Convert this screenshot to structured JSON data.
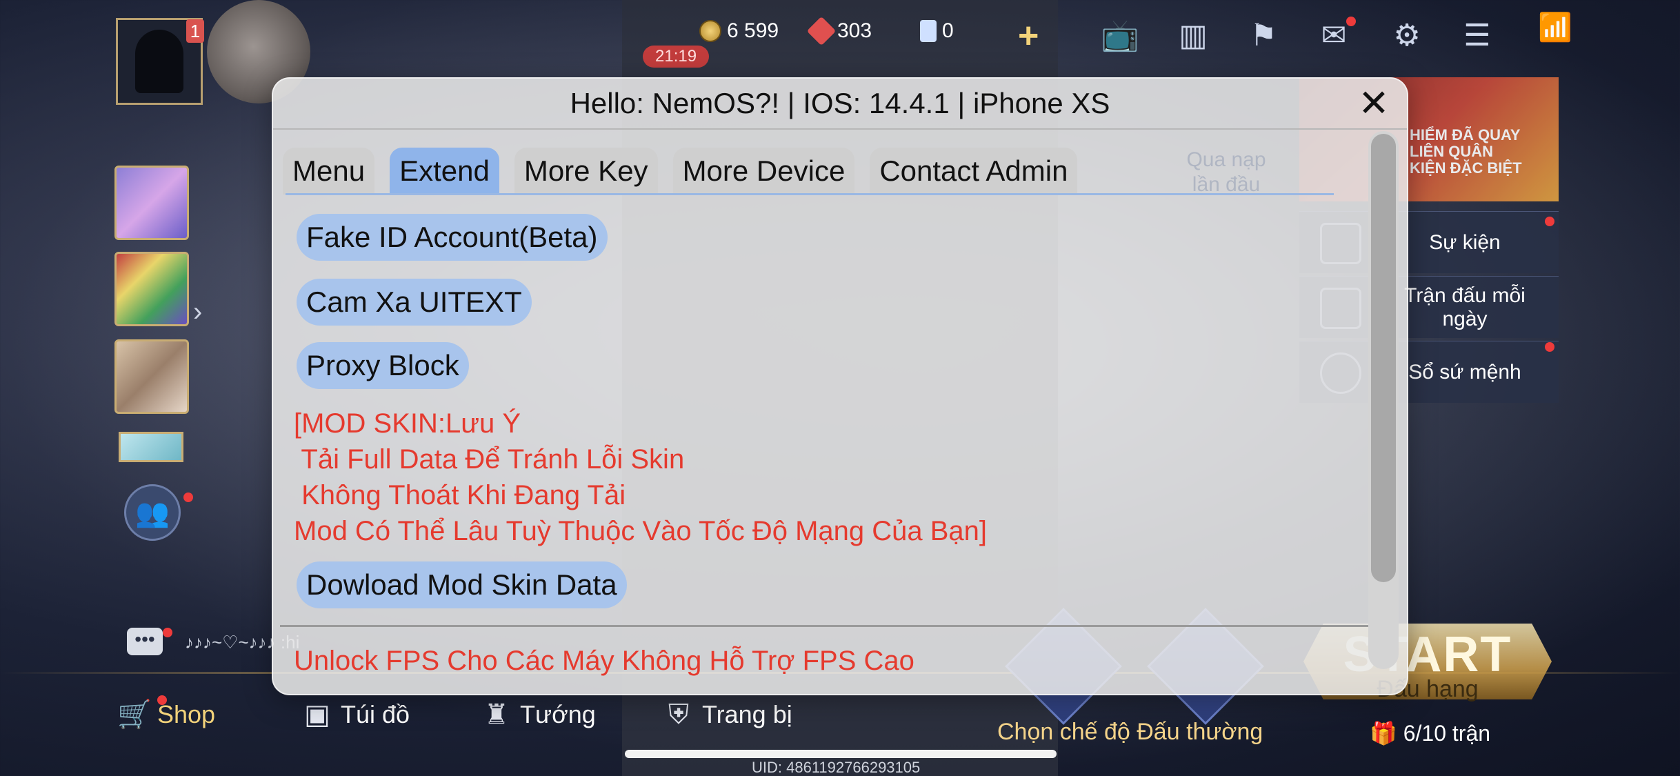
{
  "hud": {
    "coins": "6 599",
    "gems": "303",
    "vouchers": "0",
    "clock": "21:19",
    "notif_count": "1"
  },
  "events": {
    "banner_text": "HIỂM ĐÃ QUAY\nLIÊN QUÂN\nKIỆN ĐẶC BIỆT",
    "items": [
      "Sự kiện",
      "Trận đấu mỗi ngày",
      "Sổ sứ mệnh"
    ]
  },
  "background": {
    "ghost_qua": "Qua nạp\nlần đầu",
    "chat_text": "♪♪♪~♡~♪♪♪  :hi"
  },
  "bottom": {
    "shop": "Shop",
    "bag": "Túi đồ",
    "heroes": "Tướng",
    "equipment": "Trang bị",
    "start": "START",
    "start_sub": "Đấu hạng",
    "mode_label": "Chọn chế độ Đấu thường",
    "matches": "6/10 trận",
    "uid": "UID: 4861192766293105"
  },
  "panel": {
    "title": "Hello: NemOS?! | IOS: 14.4.1 | iPhone XS",
    "tabs": [
      {
        "label": "Menu"
      },
      {
        "label": "Extend"
      },
      {
        "label": "More Key"
      },
      {
        "label": "More Device"
      },
      {
        "label": "Contact Admin"
      }
    ],
    "active_tab": "Extend",
    "buttons": {
      "fake_id": "Fake ID Account(Beta)",
      "cam_xa": "Cam Xa UITEXT",
      "proxy_block": "Proxy Block",
      "download_skin": "Dowload Mod Skin Data"
    },
    "mod_note": {
      "line1": "[MOD SKIN:Lưu Ý",
      "line2": " Tải Full Data Để Tránh Lỗi Skin",
      "line3": " Không Thoát Khi Đang Tải",
      "line4": "Mod Có Thể Lâu Tuỳ Thuộc Vào Tốc Độ Mạng Của Bạn]"
    },
    "fps_note": "Unlock FPS Cho Các Máy Không Hỗ Trợ FPS Cao"
  },
  "colors": {
    "panel_bg": "#e8e8e8",
    "tab_active": "#8fb4ea",
    "pill_bg": "#a8c4ec",
    "warning_red": "#e53a2e",
    "gold": "#f2d27a"
  }
}
